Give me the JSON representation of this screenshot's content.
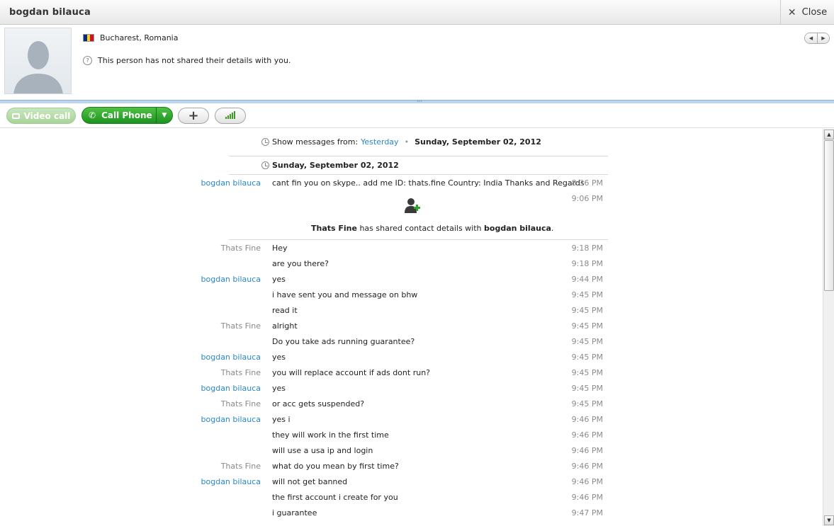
{
  "window": {
    "title": "bogdan bilauca",
    "close_label": "Close"
  },
  "profile": {
    "location": "Bucharest, Romania",
    "details_note": "This person has not shared their details with you.",
    "flag_colors": [
      "#002b7f",
      "#fcd116",
      "#ce1126"
    ]
  },
  "toolbar": {
    "video_label": "Video call",
    "call_label": "Call Phone",
    "add_icon": "plus-icon",
    "quality_icon": "signal-bars-icon"
  },
  "history": {
    "show_from_label": "Show messages from:",
    "show_from_link": "Yesterday",
    "show_from_date": "Sunday, September 02, 2012",
    "day_header": "Sunday, September 02, 2012"
  },
  "system_event": {
    "time": "9:06 PM",
    "actor": "Thats Fine",
    "middle": " has shared contact details with ",
    "target": "bogdan bilauca",
    "tail": "."
  },
  "messages": [
    {
      "author": "bogdan bilauca",
      "side": "me",
      "text": "cant fin you on skype..  add me  ID: thats.fine Country: India  Thanks and Regards",
      "time": "8:36 PM"
    },
    {
      "author": "Thats Fine",
      "side": "them",
      "text": "Hey",
      "time": "9:18 PM"
    },
    {
      "author": "",
      "side": "them",
      "text": "are you there?",
      "time": "9:18 PM"
    },
    {
      "author": "bogdan bilauca",
      "side": "me",
      "text": "yes",
      "time": "9:44 PM"
    },
    {
      "author": "",
      "side": "me",
      "text": "i have sent you and message on bhw",
      "time": "9:45 PM"
    },
    {
      "author": "",
      "side": "me",
      "text": "read it",
      "time": "9:45 PM"
    },
    {
      "author": "Thats Fine",
      "side": "them",
      "text": "alright",
      "time": "9:45 PM"
    },
    {
      "author": "",
      "side": "them",
      "text": "Do you take ads running guarantee?",
      "time": "9:45 PM"
    },
    {
      "author": "bogdan bilauca",
      "side": "me",
      "text": "yes",
      "time": "9:45 PM"
    },
    {
      "author": "Thats Fine",
      "side": "them",
      "text": "you will replace account if ads dont run?",
      "time": "9:45 PM"
    },
    {
      "author": "bogdan bilauca",
      "side": "me",
      "text": "yes",
      "time": "9:45 PM"
    },
    {
      "author": "Thats Fine",
      "side": "them",
      "text": "or acc gets suspended?",
      "time": "9:45 PM"
    },
    {
      "author": "bogdan bilauca",
      "side": "me",
      "text": "yes i",
      "time": "9:46 PM"
    },
    {
      "author": "",
      "side": "me",
      "text": "they will work in the first time",
      "time": "9:46 PM"
    },
    {
      "author": "",
      "side": "me",
      "text": "will use a usa ip and login",
      "time": "9:46 PM"
    },
    {
      "author": "Thats Fine",
      "side": "them",
      "text": "what do you mean by first time?",
      "time": "9:46 PM"
    },
    {
      "author": "bogdan bilauca",
      "side": "me",
      "text": "will not get banned",
      "time": "9:46 PM"
    },
    {
      "author": "",
      "side": "me",
      "text": "the first account i create for you",
      "time": "9:46 PM"
    },
    {
      "author": "",
      "side": "me",
      "text": "i guarantee",
      "time": "9:47 PM"
    }
  ]
}
